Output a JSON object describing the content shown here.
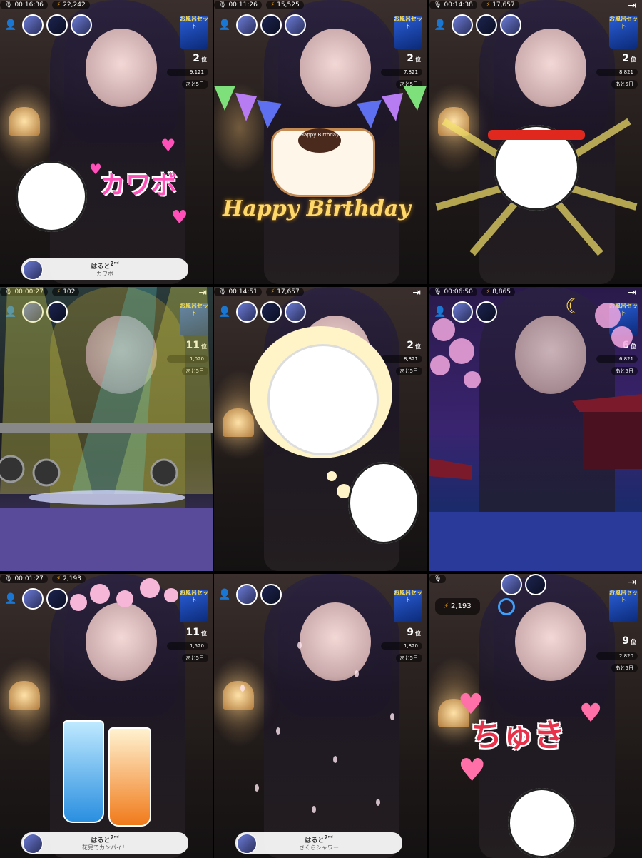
{
  "tiles": [
    {
      "time": "00:16:36",
      "viewers": "22,242",
      "rank": "2",
      "rank_unit": "位",
      "score": "9,121",
      "remaining": "あと5日",
      "effect": "kawabo",
      "effect_text": "カワボ",
      "comment_name": "はると",
      "comment_badge": "2ⁿᵈ",
      "comment_text": "カワボ"
    },
    {
      "time": "00:11:26",
      "viewers": "15,525",
      "rank": "2",
      "rank_unit": "位",
      "score": "7,821",
      "remaining": "あと5日",
      "effect": "birthday",
      "effect_text": "Happy Birthday",
      "cake_text": "Happy Birthday"
    },
    {
      "time": "00:14:38",
      "viewers": "17,657",
      "rank": "2",
      "rank_unit": "位",
      "score": "8,821",
      "remaining": "あと5日",
      "effect": "sheep-headband"
    },
    {
      "time": "00:00:27",
      "viewers": "102",
      "rank": "11",
      "rank_unit": "位",
      "score": "1,020",
      "remaining": "あと5日",
      "effect": "concert"
    },
    {
      "time": "00:14:51",
      "viewers": "17,657",
      "rank": "2",
      "rank_unit": "位",
      "score": "8,821",
      "remaining": "あと5日",
      "effect": "thought-bubble"
    },
    {
      "time": "00:06:50",
      "viewers": "8,865",
      "rank": "6",
      "rank_unit": "位",
      "score": "6,821",
      "remaining": "あと5日",
      "effect": "sakura-night"
    },
    {
      "time": "00:01:27",
      "viewers": "2,193",
      "rank": "11",
      "rank_unit": "位",
      "score": "1,520",
      "remaining": "あと5日",
      "effect": "hanami-drinks",
      "comment_name": "はると",
      "comment_badge": "2ⁿᵈ",
      "comment_text": "花見でカンパイ！"
    },
    {
      "time": "",
      "viewers": "",
      "rank": "9",
      "rank_unit": "位",
      "score": "1,820",
      "remaining": "あと5日",
      "effect": "sakura-shower",
      "comment_name": "はると",
      "comment_badge": "2ⁿᵈ",
      "comment_text": "さくらシャワー"
    },
    {
      "time": "",
      "viewers": "2,193",
      "rank": "9",
      "rank_unit": "位",
      "score": "2,820",
      "remaining": "あと5日",
      "effect": "chuki",
      "effect_text": "ちゅき"
    }
  ],
  "promo_label": "お風呂セット",
  "colors": {
    "bolt": "#ffb21e",
    "heart": "#ff4fb8",
    "comment_bg": "#ffffff"
  }
}
